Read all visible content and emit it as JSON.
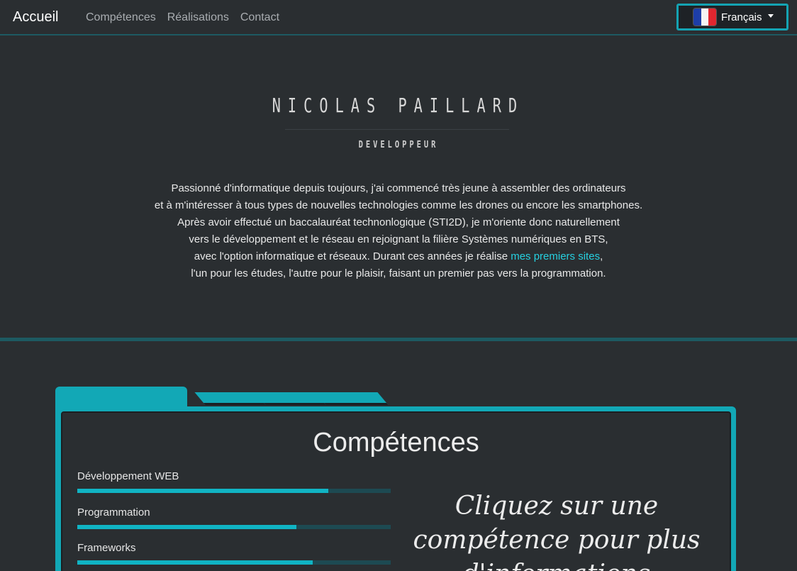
{
  "navbar": {
    "brand": "Accueil",
    "links": [
      "Compétences",
      "Réalisations",
      "Contact"
    ],
    "language": {
      "label": "Français",
      "flag": "flag-france-icon"
    }
  },
  "hero": {
    "name": "NICOLAS PAILLARD",
    "role": "DEVELOPPEUR",
    "bio_lines": [
      "Passionné d'informatique depuis toujours, j'ai commencé très jeune à assembler des ordinateurs",
      "et à m'intéresser à tous types de nouvelles technologies comme les drones ou encore les smartphones.",
      "Après avoir effectué un baccalauréat technonlogique (STI2D), je m'oriente donc naturellement",
      "vers le développement et le réseau en rejoignant la filière Systèmes numériques en BTS,"
    ],
    "bio_line5_before": "avec l'option informatique et réseaux. Durant ces années je réalise ",
    "bio_link": "mes premiers sites",
    "bio_line5_after": ",",
    "bio_line6": "l'un pour les études, l'autre pour le plaisir, faisant un premier pas vers la programmation."
  },
  "skills": {
    "title": "Compétences",
    "items": [
      {
        "label": "Développement WEB",
        "level": 0.8
      },
      {
        "label": "Programmation",
        "level": 0.7
      },
      {
        "label": "Frameworks",
        "level": 0.75
      }
    ],
    "hint": "Cliquez sur une compétence pour plus d'informations"
  },
  "colors": {
    "accent": "#12a8b6",
    "background": "#2a2e31",
    "link": "#26d0e0"
  }
}
